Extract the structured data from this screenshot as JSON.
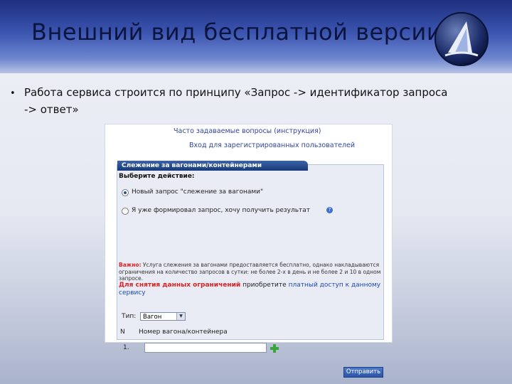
{
  "slide": {
    "title": "Внешний вид бесплатной версии",
    "bullet_marker": "•",
    "bullet_text": "Работа сервиса строится по принципу «Запрос -> идентификатор запроса -> ответ»"
  },
  "screenshot": {
    "link_faq": "Часто задаваемые вопросы (инструкция)",
    "link_login": "Вход для зарегистрированных пользователей",
    "panel_tab": "Слежение за вагонами/контейнерами",
    "choose_action": "Выберите действие:",
    "option_new": "Новый запрос \"слежение за вагонами\"",
    "option_existing": "Я уже формировал запрос, хочу получить результат",
    "help_glyph": "?",
    "warning_label": "Важно:",
    "warning_text": "Услуга слежения за вагонами предоставляется бесплатно, однако накладываются ограничения на количество запросов в сутки: не более 2-х в день и не более 2 и 10 в одном запросе.",
    "pay_red": "Для снятия данных ограничений",
    "pay_mid": "приобретите",
    "pay_link": "платный доступ к данному сервису",
    "type_label": "Тип:",
    "type_value": "Вагон",
    "col_n": "N",
    "col_number": "Номер вагона/контейнера",
    "row_index": "1.",
    "send_button": "Отправить"
  },
  "colors": {
    "title_band": "#3b55b0",
    "panel_tab": "#1e4688",
    "warning_red": "#d22222",
    "link_blue": "#2f46a0",
    "add_icon": "#3aa53a"
  }
}
